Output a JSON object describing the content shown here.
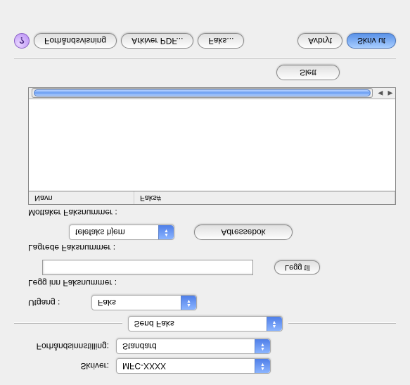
{
  "printer": {
    "label": "Skriver:",
    "value": "MFC-XXXX"
  },
  "preset": {
    "label": "Forhåndsinnstilling:",
    "value": "Standard"
  },
  "section": {
    "value": "Send Faks"
  },
  "output": {
    "label": "Utgang :",
    "value": "Faks"
  },
  "input_fax": {
    "label": "Legg inn Faksnummer :",
    "add_btn": "Legg til",
    "value": ""
  },
  "saved_fax": {
    "label": "Lagrede Faksnummer :",
    "select_value": "telefaks hjem",
    "addr_btn": "Adressebok"
  },
  "recipients": {
    "label": "Mottaker Faksnummer :",
    "col_name": "Navn",
    "col_fax": "Faks#"
  },
  "delete_btn": "Slett",
  "footer": {
    "preview": "Forhåndsvisning",
    "save_pdf": "Arkiver PDF...",
    "fax": "Faks...",
    "cancel": "Avbryt",
    "print": "Skriv ut",
    "help": "?"
  }
}
